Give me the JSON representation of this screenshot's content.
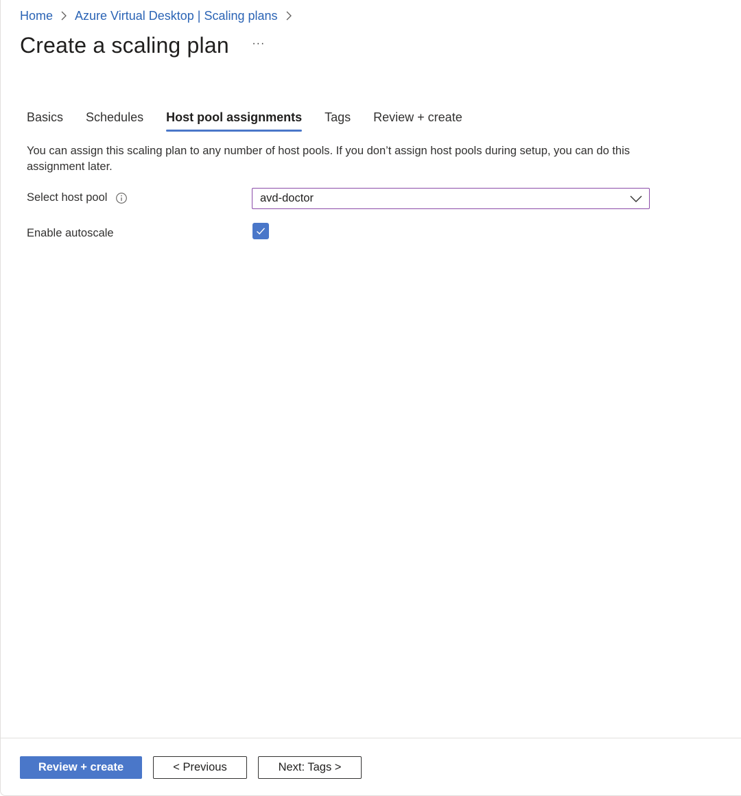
{
  "breadcrumb": {
    "items": [
      "Home",
      "Azure Virtual Desktop | Scaling plans"
    ]
  },
  "page": {
    "title": "Create a scaling plan",
    "more_label": "···"
  },
  "tabs": [
    {
      "label": "Basics",
      "active": false
    },
    {
      "label": "Schedules",
      "active": false
    },
    {
      "label": "Host pool assignments",
      "active": true
    },
    {
      "label": "Tags",
      "active": false
    },
    {
      "label": "Review + create",
      "active": false
    }
  ],
  "main": {
    "description": "You can assign this scaling plan to any number of host pools. If you don’t assign host pools during setup, you can do this assignment later.",
    "host_pool": {
      "label": "Select host pool",
      "value": "avd-doctor",
      "info_icon": "info-icon"
    },
    "autoscale": {
      "label": "Enable autoscale",
      "checked": true
    }
  },
  "footer": {
    "review_create_label": "Review + create",
    "previous_label": "< Previous",
    "next_label": "Next: Tags >"
  },
  "colors": {
    "accent": "#4a77c9",
    "link": "#2b64b5",
    "select_border": "#8a4aa8"
  }
}
